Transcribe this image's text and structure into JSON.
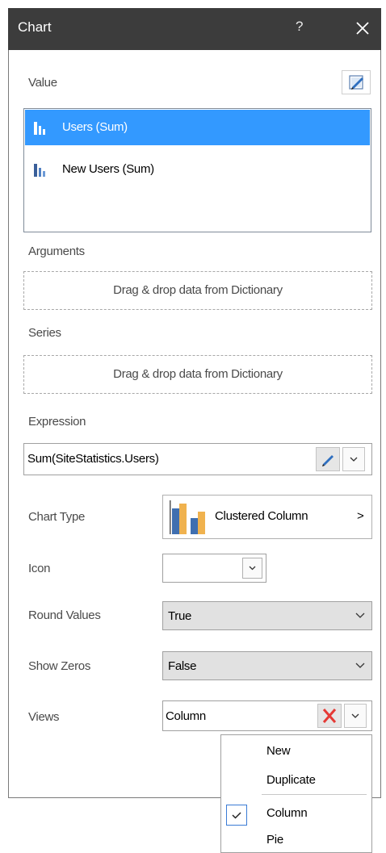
{
  "window": {
    "title": "Chart",
    "help": "?",
    "close_icon": "close-icon"
  },
  "value_section": {
    "label": "Value",
    "edit_icon": "edit-pencil-icon",
    "items": [
      {
        "label": "Users (Sum)",
        "selected": true,
        "icon": "bar-chart-icon"
      },
      {
        "label": "New Users (Sum)",
        "selected": false,
        "icon": "bar-chart-icon"
      }
    ]
  },
  "arguments": {
    "label": "Arguments",
    "placeholder": "Drag & drop data from Dictionary"
  },
  "series": {
    "label": "Series",
    "placeholder": "Drag & drop data from Dictionary"
  },
  "expression": {
    "label": "Expression",
    "value": "Sum(SiteStatistics.Users)"
  },
  "chart_type": {
    "label": "Chart Type",
    "value": "Clustered Column",
    "arrow": ">"
  },
  "icon_field": {
    "label": "Icon",
    "value": ""
  },
  "round_values": {
    "label": "Round Values",
    "value": "True"
  },
  "show_zeros": {
    "label": "Show Zeros",
    "value": "False"
  },
  "views": {
    "label": "Views",
    "value": "Column",
    "menu": [
      {
        "label": "New",
        "checked": false
      },
      {
        "label": "Duplicate",
        "checked": false
      },
      {
        "label": "Column",
        "checked": true
      },
      {
        "label": "Pie",
        "checked": false
      }
    ]
  },
  "colors": {
    "accent": "#3399ff",
    "titlebar": "#3c3c3c",
    "delete": "#e53935"
  }
}
